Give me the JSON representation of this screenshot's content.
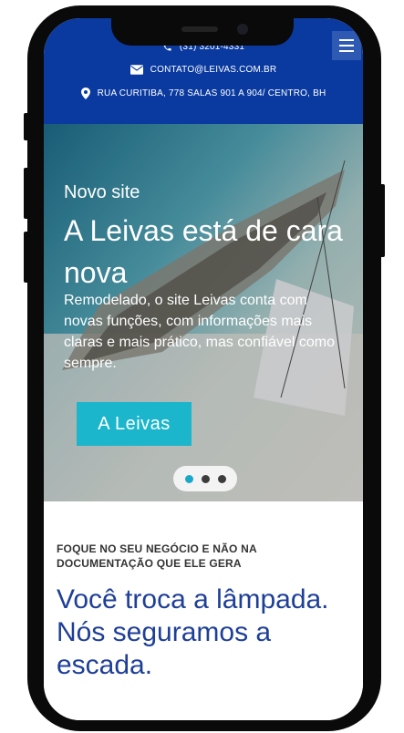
{
  "topbar": {
    "phone": "(31) 3201-4331",
    "email": "CONTATO@LEIVAS.COM.BR",
    "address": "RUA CURITIBA, 778 SALAS 901 A 904/ CENTRO, BH",
    "icons": [
      "phone-icon",
      "envelope-icon",
      "map-pin-icon",
      "menu-icon"
    ]
  },
  "hero": {
    "kicker": "Novo site",
    "headline": "A Leivas está de cara nova",
    "description": "Remodelado, o site Leivas conta com novas funções, com informações mais claras e mais prático, mas confiável como sempre.",
    "cta_label": "A Leivas",
    "slides": 3,
    "active_slide": 1
  },
  "section": {
    "eyebrow": "FOQUE NO SEU NEGÓCIO E NÃO NA DOCUMENTAÇÃO QUE ELE GERA",
    "headline": "Você troca a lâmpada. Nós seguramos a escada."
  },
  "colors": {
    "topbar": "#0a3aa0",
    "cta": "#1bb6cc",
    "headline": "#1e3f98",
    "active_dot": "#19a9c8"
  }
}
